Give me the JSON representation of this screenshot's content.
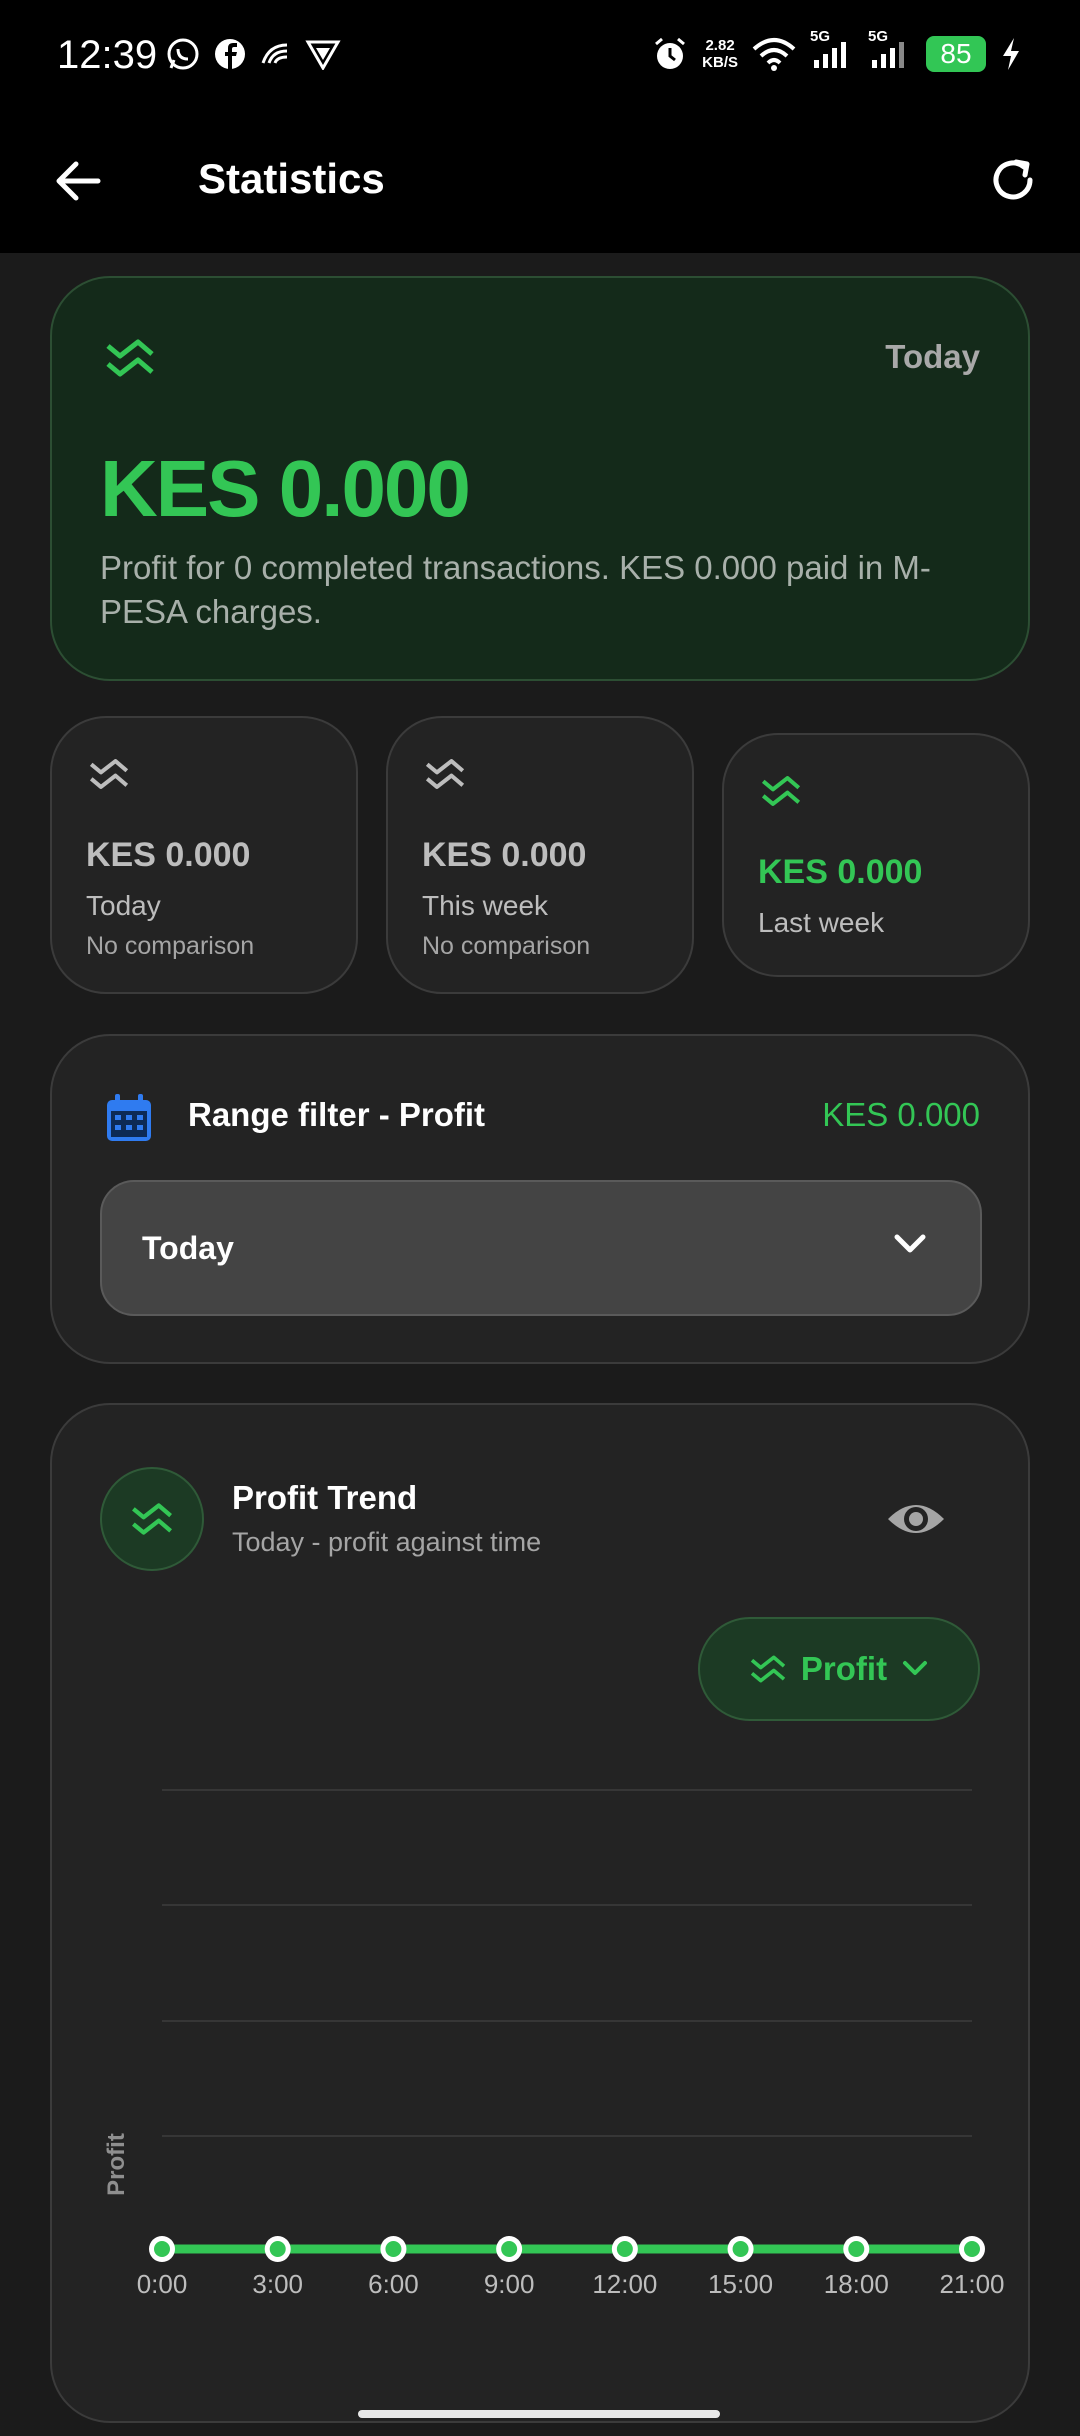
{
  "status_bar": {
    "time": "12:39",
    "net_speed_value": "2.82",
    "net_speed_unit": "KB/S",
    "sim1_label": "5G",
    "sim2_label": "5G",
    "battery_level": "85",
    "left_icons": [
      "whatsapp-icon",
      "facebook-icon",
      "app-notification-icon",
      "vpn-icon"
    ],
    "right_icons": [
      "alarm-icon",
      "wifi-icon",
      "signal-icon",
      "signal-icon",
      "charging-icon"
    ]
  },
  "app_bar": {
    "title": "Statistics"
  },
  "hero": {
    "period": "Today",
    "amount": "KES 0.000",
    "description": "Profit for 0 completed transactions. KES 0.000 paid in M-PESA charges.",
    "icon": "profit-trend-icon"
  },
  "summary_cards": [
    {
      "amount": "KES 0.000",
      "label": "Today",
      "comparison": "No comparison"
    },
    {
      "amount": "KES 0.000",
      "label": "This week",
      "comparison": "No comparison"
    },
    {
      "amount": "KES 0.000",
      "label": "Last week"
    }
  ],
  "range_filter": {
    "title": "Range filter - Profit",
    "value": "KES 0.000",
    "selected": "Today"
  },
  "trend": {
    "title": "Profit Trend",
    "subtitle": "Today - profit against time",
    "metric_label": "Profit"
  },
  "colors": {
    "accent_green": "#33c655",
    "card_bg": "#232323",
    "hero_bg": "#142a1a",
    "calendar_blue": "#2f7bf0"
  },
  "chart_data": {
    "type": "line",
    "title": "",
    "xlabel": "",
    "ylabel": "Profit",
    "x": [
      "0:00",
      "3:00",
      "6:00",
      "9:00",
      "12:00",
      "15:00",
      "18:00",
      "21:00"
    ],
    "series": [
      {
        "values": [
          0,
          0,
          0,
          0,
          0,
          0,
          0,
          0
        ]
      }
    ],
    "grid": true,
    "legend": "none"
  }
}
